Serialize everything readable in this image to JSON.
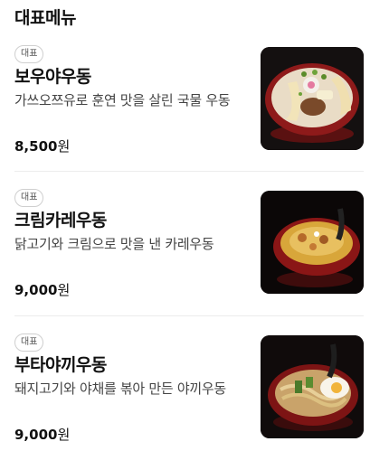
{
  "section": {
    "title": "대표메뉴"
  },
  "items": [
    {
      "badge": "대표",
      "name": "보우야우동",
      "desc": "가쓰오쯔유로 훈연 맛을 살린 국물 우동",
      "price": "8,500",
      "currency": "원",
      "image_icon": "bowl-udon-photo"
    },
    {
      "badge": "대표",
      "name": "크림카레우동",
      "desc": "닭고기와 크림으로 맛을 낸 카레우동",
      "price": "9,000",
      "currency": "원",
      "image_icon": "bowl-curry-udon-photo"
    },
    {
      "badge": "대표",
      "name": "부타야끼우동",
      "desc": "돼지고기와 야채를 볶아 만든 야끼우동",
      "price": "9,000",
      "currency": "원",
      "image_icon": "bowl-yaki-udon-photo"
    }
  ]
}
